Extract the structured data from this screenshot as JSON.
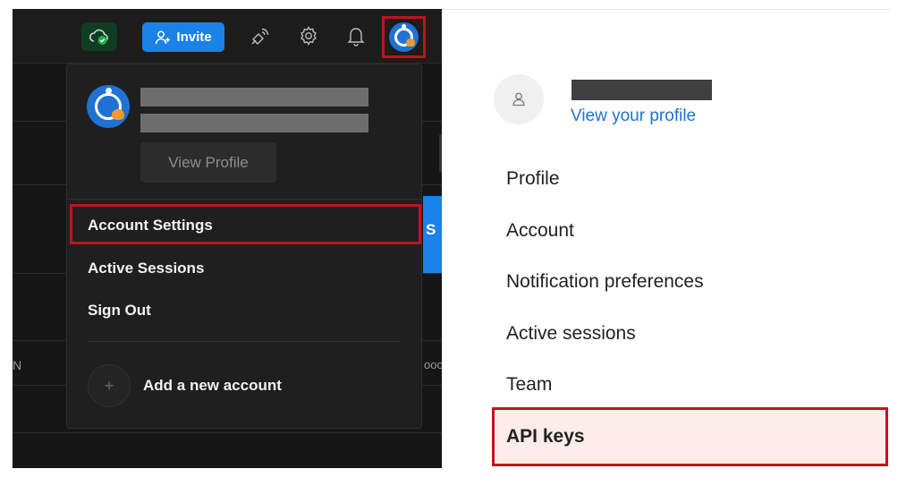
{
  "topbar": {
    "invite_label": "Invite"
  },
  "background": {
    "edge_letter": "S",
    "row_letter": "N",
    "row_more": "ooo"
  },
  "dropdown": {
    "view_profile_label": "View Profile",
    "items": [
      "Account Settings",
      "Active Sessions",
      "Sign Out"
    ],
    "add_account_label": "Add a new account",
    "add_account_icon": "+"
  },
  "settings_menu": {
    "view_your_profile": "View your profile",
    "items": [
      "Profile",
      "Account",
      "Notification preferences",
      "Active sessions",
      "Team"
    ],
    "selected_item": "API keys"
  },
  "colors": {
    "accent_blue": "#1a82e8",
    "highlight_red": "#c0141c",
    "selected_bg": "#fdece8",
    "link_blue": "#1a73d6"
  },
  "icons": {
    "cloud": "cloud-check-icon",
    "invite": "add-user-icon",
    "satellite": "satellite-icon",
    "settings": "gear-icon",
    "notifications": "bell-icon",
    "avatar": "user-avatar-icon",
    "profile_placeholder": "person-icon"
  }
}
